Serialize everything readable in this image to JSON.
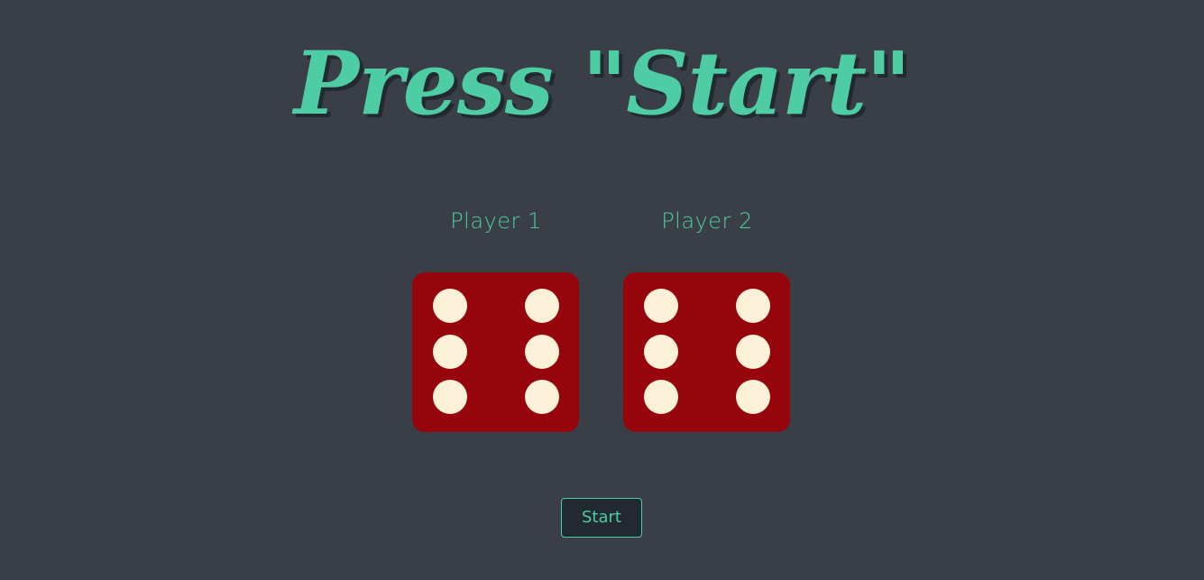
{
  "title": "Press \"Start\"",
  "players": [
    {
      "label": "Player 1",
      "die_value": 6
    },
    {
      "label": "Player 2",
      "die_value": 6
    }
  ],
  "start_button": {
    "label": "Start"
  },
  "colors": {
    "background": "#393e47",
    "accent": "#4ecca3",
    "die_face": "#96050c",
    "pip": "#fbf0d8",
    "button_background": "#232931"
  }
}
